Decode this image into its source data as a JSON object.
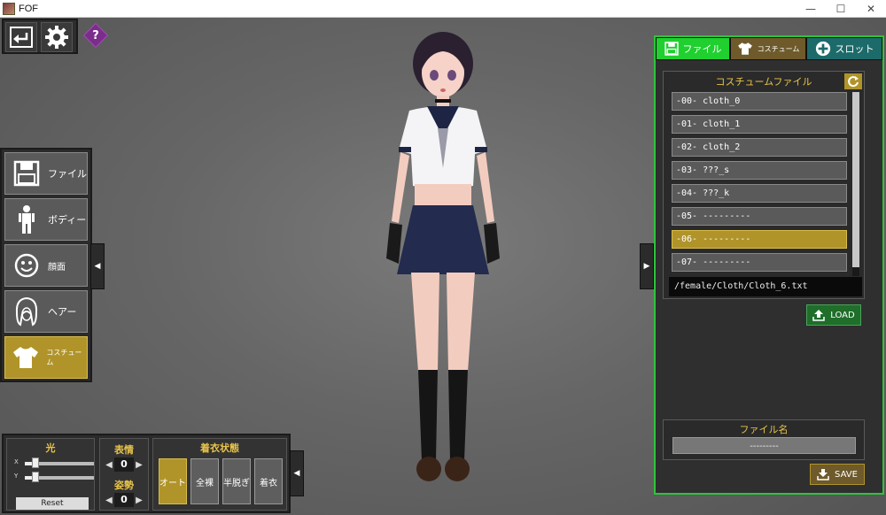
{
  "window": {
    "title": "FOF",
    "controls": [
      "—",
      "☐",
      "✕"
    ]
  },
  "top_tools": {
    "back_icon": "back-icon",
    "settings_icon": "gear-icon",
    "help_label": "?"
  },
  "left_menu": {
    "items": [
      {
        "label": "ファイル",
        "icon": "save-icon",
        "active": false
      },
      {
        "label": "ボディー",
        "icon": "body-icon",
        "active": false
      },
      {
        "label": "顔面",
        "icon": "face-icon",
        "active": false
      },
      {
        "label": "ヘアー",
        "icon": "hair-icon",
        "active": false
      },
      {
        "label": "コスチューム",
        "icon": "tshirt-icon",
        "active": true
      }
    ],
    "collapse_arrow": "◀"
  },
  "bottom_panel": {
    "light": {
      "title": "光",
      "x_label": "X",
      "y_label": "Y",
      "x_value": 0.15,
      "y_value": 0.15,
      "reset_label": "Reset"
    },
    "expression": {
      "title": "表情",
      "value": "0"
    },
    "pose": {
      "title": "姿勢",
      "value": "0"
    },
    "clothing_state": {
      "title": "着衣状態",
      "buttons": [
        {
          "label": "オート",
          "active": true
        },
        {
          "label": "全裸",
          "active": false
        },
        {
          "label": "半脱ぎ",
          "active": false
        },
        {
          "label": "着衣",
          "active": false
        }
      ]
    },
    "collapse_arrow": "◀"
  },
  "right_collapse_arrow": "▶",
  "right_panel": {
    "tabs": [
      {
        "label": "ファイル",
        "icon": "save-icon"
      },
      {
        "label": "コスチューム",
        "icon": "tshirt-icon"
      },
      {
        "label": "スロット",
        "icon": "plus-circle-icon"
      }
    ],
    "file_box": {
      "title": "コスチュームファイル",
      "files": [
        "-00- cloth_0",
        "-01- cloth_1",
        "-02- cloth_2",
        "-03- ???_s",
        "-04- ???_k",
        "-05- ---------",
        "-06- ---------",
        "-07- ---------"
      ],
      "selected_index": 6,
      "path": "/female/Cloth/Cloth_6.txt",
      "load_label": "LOAD"
    },
    "file_name": {
      "title": "ファイル名",
      "value": "---------"
    },
    "save_label": "SAVE"
  },
  "colors": {
    "accent_gold": "#b0942a",
    "accent_green": "#1fd02f",
    "panel_border": "#2ec43a",
    "label_gold": "#e8c34a"
  }
}
